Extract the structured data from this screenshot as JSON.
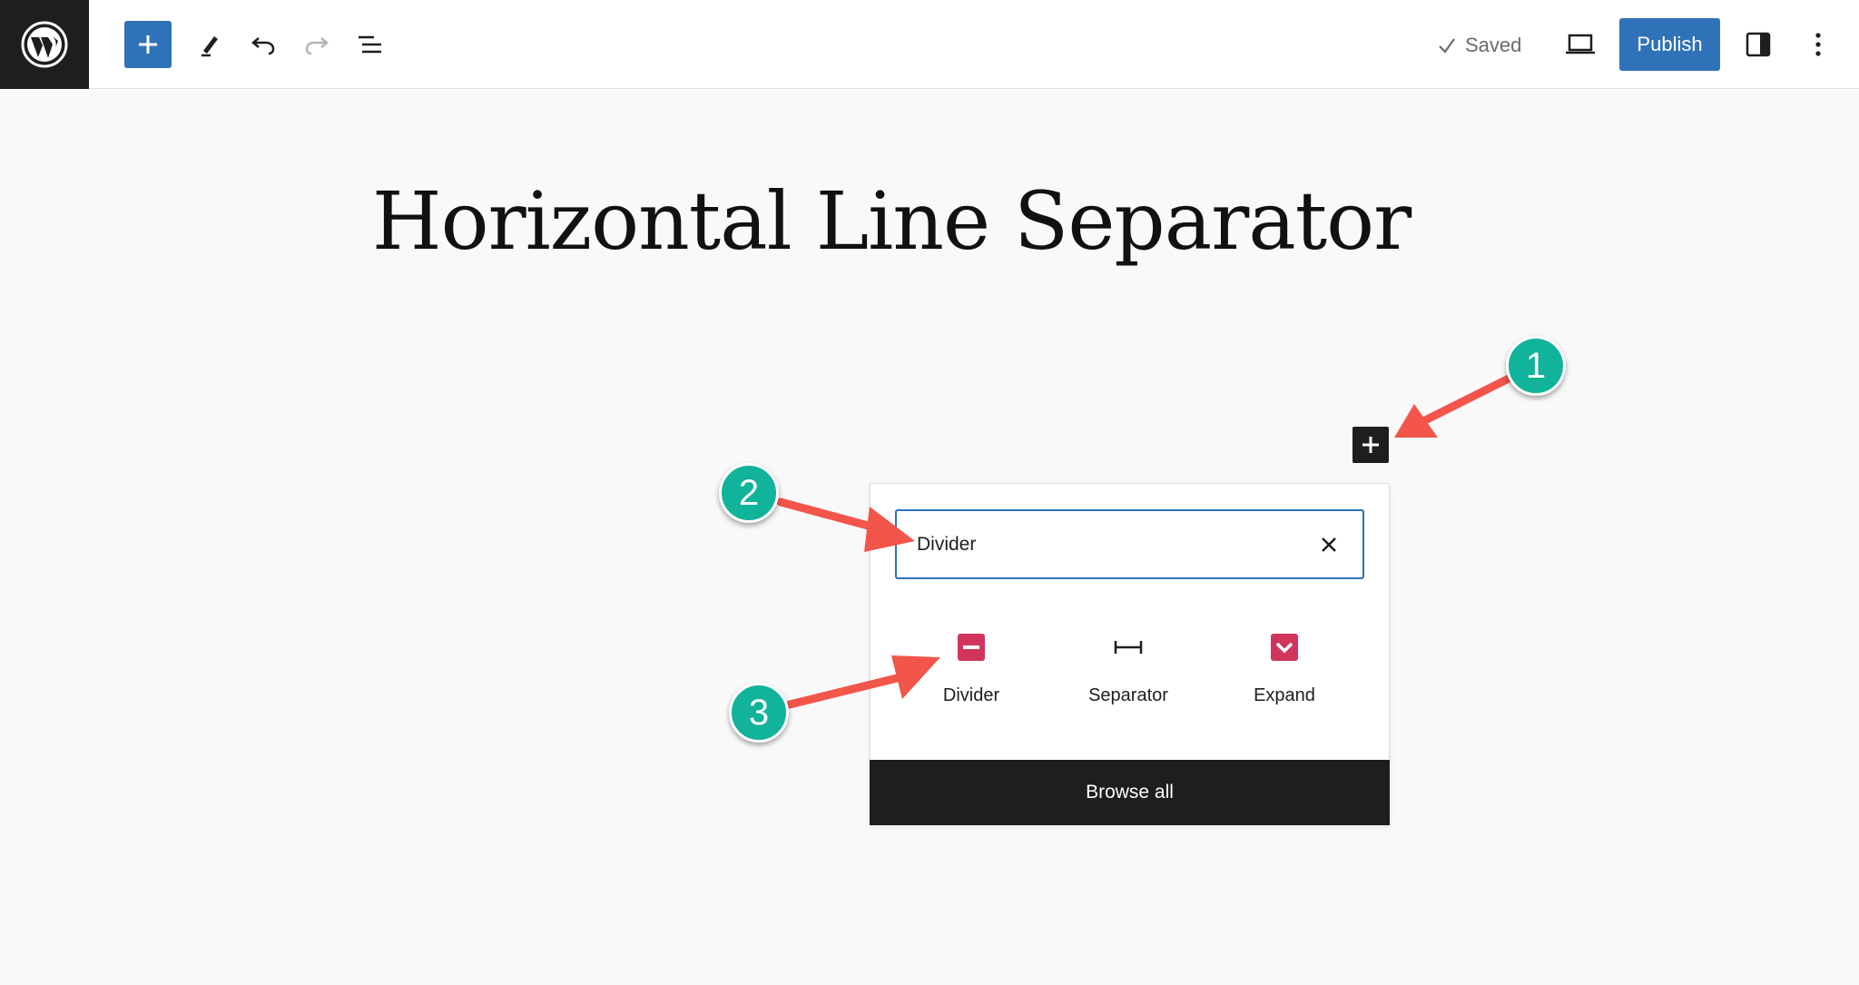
{
  "toolbar": {
    "logo_icon": "wordpress-logo-icon",
    "add_block_icon": "plus-icon",
    "tools_icon": "pencil-icon",
    "undo_icon": "undo-icon",
    "redo_icon": "redo-icon",
    "document_overview_icon": "list-view-icon",
    "saved_label": "Saved",
    "saved_icon": "check-icon",
    "preview_icon": "laptop-icon",
    "publish_label": "Publish",
    "settings_icon": "sidebar-toggle-icon",
    "options_icon": "vertical-ellipsis-icon"
  },
  "editor": {
    "post_title": "Horizontal Line Separator",
    "block_inserter_icon": "plus-icon"
  },
  "inserter": {
    "search_value": "Divider",
    "clear_icon": "close-icon",
    "results": [
      {
        "label": "Divider",
        "icon": "divider-block-icon",
        "color": "#d0365c"
      },
      {
        "label": "Separator",
        "icon": "separator-block-icon",
        "color": "#1e1e1e"
      },
      {
        "label": "Expand",
        "icon": "expand-block-icon",
        "color": "#d0365c"
      }
    ],
    "browse_all_label": "Browse all"
  },
  "annotations": {
    "badges": [
      "1",
      "2",
      "3"
    ],
    "badge_color": "#11b39a",
    "arrow_color": "#f2554a"
  },
  "colors": {
    "accent": "#3072b7",
    "dark": "#1e1e1e",
    "canvas": "#f9f9f9"
  }
}
